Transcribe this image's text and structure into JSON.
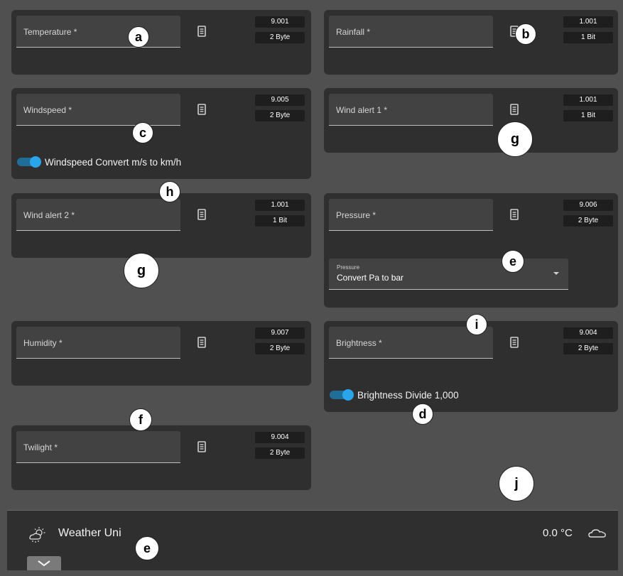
{
  "cards": [
    {
      "label": "Temperature *",
      "code": "9.001",
      "size": "2 Byte"
    },
    {
      "label": "Rainfall *",
      "code": "1.001",
      "size": "1 Bit"
    },
    {
      "label": "Windspeed *",
      "code": "9.005",
      "size": "2 Byte",
      "toggle": "Windspeed Convert m/s to km/h"
    },
    {
      "label": "Wind alert 1 *",
      "code": "1.001",
      "size": "1 Bit"
    },
    {
      "label": "Wind alert 2 *",
      "code": "1.001",
      "size": "1 Bit"
    },
    {
      "label": "Pressure *",
      "code": "9.006",
      "size": "2 Byte",
      "select_caption": "Pressure",
      "select_value": "Convert Pa to bar"
    },
    {
      "label": "Humidity *",
      "code": "9.007",
      "size": "2 Byte"
    },
    {
      "label": "Brightness *",
      "code": "9.004",
      "size": "2 Byte",
      "toggle": "Brightness Divide 1,000"
    },
    {
      "label": "Twilight *",
      "code": "9.004",
      "size": "2 Byte"
    }
  ],
  "markers": {
    "a": "a",
    "b": "b",
    "c": "c",
    "g1": "g",
    "h": "h",
    "g2": "g",
    "e1": "e",
    "i": "i",
    "d": "d",
    "f": "f",
    "j": "j",
    "e2": "e"
  },
  "bottom": {
    "title": "Weather Uni",
    "temperature": "0.0 °C",
    "weather_icon": "sun-cloud-icon",
    "status_icon": "cloud-icon",
    "expand_icon": "chevron-down-icon"
  },
  "colors": {
    "background": "#505050",
    "card": "#2f2f2f",
    "field": "#424242",
    "badge": "#1e1e1e",
    "toggle_accent": "#29a6ea"
  }
}
